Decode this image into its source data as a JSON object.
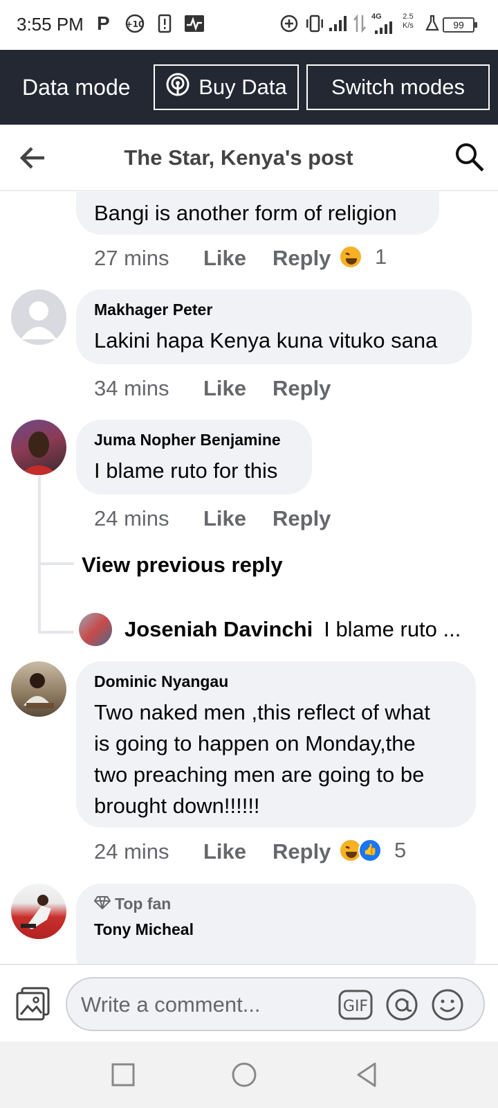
{
  "status_bar": {
    "time": "3:55 PM",
    "network": "4G",
    "speed_value": "2.5",
    "speed_unit": "K/s",
    "battery": "99"
  },
  "data_bar": {
    "title": "Data mode",
    "buy_label": "Buy Data",
    "switch_label": "Switch modes"
  },
  "header": {
    "title": "The Star, Kenya's post"
  },
  "comments": [
    {
      "text": "Bangi is another form of religion",
      "time": "27 mins",
      "like": "Like",
      "reply": "Reply",
      "reaction_count": "1"
    },
    {
      "name": "Makhager Peter",
      "text": "Lakini hapa Kenya kuna vituko sana",
      "time": "34 mins",
      "like": "Like",
      "reply": "Reply"
    },
    {
      "name": "Juma Nopher Benjamine",
      "text": "I blame ruto for this",
      "time": "24 mins",
      "like": "Like",
      "reply": "Reply",
      "view_previous": "View previous reply",
      "reply_preview": {
        "name": "Joseniah Davinchi",
        "text": "I blame ruto ..."
      }
    },
    {
      "name": "Dominic Nyangau",
      "text_lines": [
        "Two naked men ,this reflect of what",
        "is going to happen on Monday,the",
        "two preaching men are going to be",
        "brought down!!!!!!"
      ],
      "time": "24 mins",
      "like": "Like",
      "reply": "Reply",
      "reaction_count": "5"
    },
    {
      "badge": "Top fan",
      "name": "Tony Micheal"
    }
  ],
  "composer": {
    "placeholder": "Write a comment...",
    "gif_label": "GIF"
  },
  "colors": {
    "data_bar_bg": "#232833",
    "bubble_bg": "#f0f2f5",
    "meta_text": "#65676b",
    "like_blue": "#1877f2",
    "haha_yellow": "#f7b125"
  }
}
